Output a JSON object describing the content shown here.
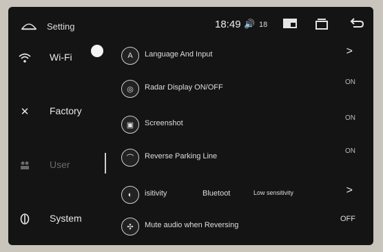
{
  "statusbar": {
    "title": "Setting",
    "time": "18:49",
    "volume_icon": "🔊",
    "volume_level": "18"
  },
  "nav": [
    {
      "label": "Wi-Fi",
      "icon": "wifi-icon"
    },
    {
      "label": "Factory",
      "icon": "wrench-icon"
    },
    {
      "label": "User",
      "icon": "user-icon"
    },
    {
      "label": "System",
      "icon": "system-icon"
    }
  ],
  "rows": [
    {
      "label": "Language And Input",
      "value": "",
      "chevron": ">"
    },
    {
      "label": "Radar Display ON/OFF",
      "value": "ON"
    },
    {
      "label": "Screenshot",
      "value": "ON"
    },
    {
      "label": "Reverse Parking Line",
      "value": "ON"
    },
    {
      "label": "isitivity",
      "extra1": "Bluetoot",
      "extra2": "Low sensitivity",
      "chevron": ">"
    },
    {
      "label": "Mute audio when Reversing",
      "value": "OFF"
    }
  ]
}
